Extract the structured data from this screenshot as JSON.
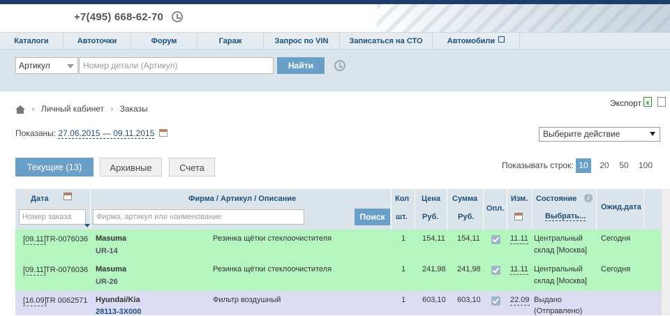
{
  "header": {
    "phone": "+7(495) 668-62-70"
  },
  "nav": [
    "Каталоги",
    "Автоточки",
    "Форум",
    "Гараж",
    "Запрос по VIN",
    "Записаться на СТО",
    "Автомобили"
  ],
  "search": {
    "type_value": "Артикул",
    "placeholder": "Номер детали (Артикул)",
    "button": "Найти"
  },
  "breadcrumb": {
    "home_icon": "home-icon",
    "items": [
      "Личный кабинет",
      "Заказы"
    ]
  },
  "export_label": "Экспорт",
  "period": {
    "label": "Показаны:",
    "range": "27.06.2015 — 09.11.2015"
  },
  "action_select": "Выберите действие",
  "tabs": [
    "Текущие (13)",
    "Архивные",
    "Счета"
  ],
  "rows_per_page": {
    "label": "Показывать строк:",
    "options": [
      "10",
      "20",
      "50",
      "100"
    ],
    "selected": "10"
  },
  "table": {
    "headers": {
      "date": "Дата",
      "firm": "Фирма / Артикул / Описание",
      "qty": "Кол",
      "qty_unit": "шт.",
      "price": "Цена",
      "price_unit": "Руб.",
      "sum": "Сумма",
      "sum_unit": "Руб.",
      "paid": "Опл.",
      "changed": "Изм.",
      "status": "Состояние",
      "status_select": "Выбрать...",
      "expected": "Ожид.дата"
    },
    "order_placeholder": "Номер заказа",
    "firm_placeholder": "Фирма, артикул или наименование",
    "search_button": "Поиск",
    "rows": [
      {
        "date": "[09.11]",
        "order": "TR-0076036",
        "brand": "Masuma",
        "article": "UR-14",
        "description": "Резинка щётки стеклоочистителя",
        "qty": "1",
        "price": "154,11",
        "sum": "154,11",
        "paid": true,
        "changed": "11.11",
        "status1": "Центральный",
        "status2": "склад [Москва]",
        "expected": "Сегодня",
        "color": "#b5f5c0"
      },
      {
        "date": "[09.11]",
        "order": "TR-0076036",
        "brand": "Masuma",
        "article": "UR-26",
        "description": "Резинка щётки стеклоочистителя",
        "qty": "1",
        "price": "241,98",
        "sum": "241,98",
        "paid": true,
        "changed": "11.11",
        "status1": "Центральный",
        "status2": "склад [Москва]",
        "expected": "Сегодня",
        "color": "#b5f5c0"
      },
      {
        "date": "[16.09]",
        "order": "TR 0062571",
        "brand": "Hyundai/Kia",
        "article": "28113-3X000",
        "description": "Фильтр воздушный",
        "qty": "1",
        "price": "603,10",
        "sum": "603,10",
        "paid": true,
        "changed": "22.09",
        "status1": "Выдано",
        "status2": "(Отправлено)",
        "expected": "",
        "color": "#dcdcf5"
      }
    ]
  }
}
